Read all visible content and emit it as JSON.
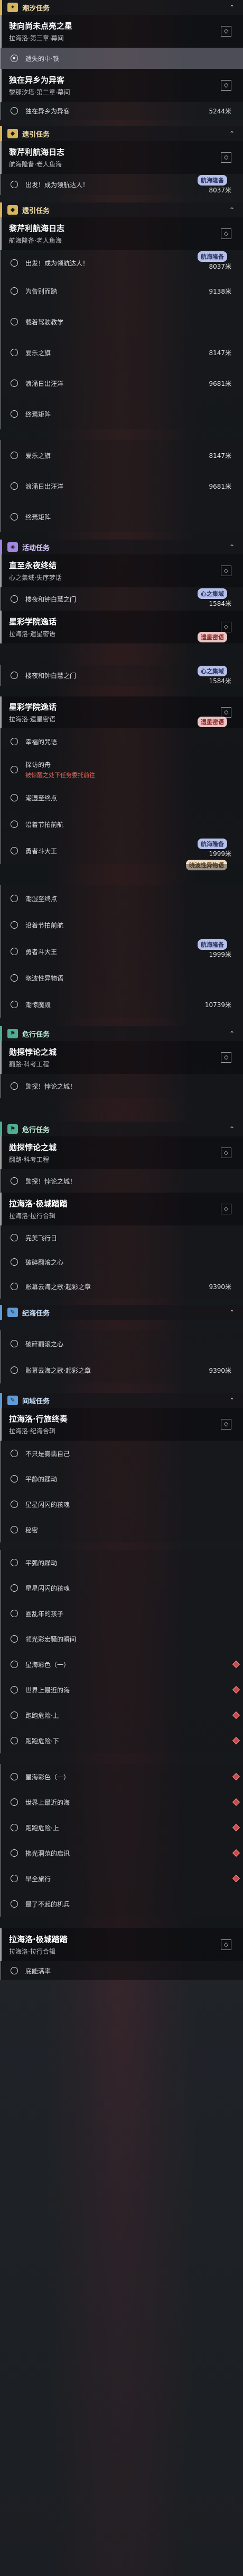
{
  "sections": {
    "s1_header": "潮汐任务",
    "s1_q1_title": "驶向尚未点亮之星",
    "s1_q1_sub": "拉海洛·第三章·幕间",
    "s1_q1_step": "遗失的中·铁",
    "s1_q2_title": "独在异乡为异客",
    "s1_q2_sub": "黎那汐塔·第二章·幕间",
    "s1_q2_step": "独在异乡为异客",
    "s1_q2_dist": "5244米",
    "s2_header": "遗引任务",
    "s2_q1_title": "黎芹利航海日志",
    "s2_q1_sub": "航海隆备·老人鱼海",
    "s2_q1_step": "出发！成为领航达人！",
    "s2_q1_badge": "航海隆备",
    "s2_q1_dist": "8037米",
    "s3_header": "遗引任务",
    "s3_q1_title": "黎芹利航海日志",
    "s3_q1_sub": "航海隆备·老人鱼海",
    "s3_steps": [
      {
        "label": "出发！成为领航达人！",
        "dist": "8037米",
        "badge": "航海隆备"
      },
      {
        "label": "为告别而踏",
        "dist": "9138米"
      },
      {
        "label": "载着驾驶教学",
        "dist": ""
      },
      {
        "label": "爱乐之旗",
        "dist": "8147米"
      },
      {
        "label": "浪涌日出汪洋",
        "dist": "9681米"
      },
      {
        "label": "终焉矩阵",
        "dist": ""
      }
    ],
    "s3b_steps": [
      {
        "label": "爱乐之旗",
        "dist": "8147米"
      },
      {
        "label": "浪涌日出汪洋",
        "dist": "9681米"
      },
      {
        "label": "终焉矩阵",
        "dist": ""
      }
    ],
    "s4_header": "活动任务",
    "s4_q1_title": "直至永夜终结",
    "s4_q1_sub": "心之集域·失序梦话",
    "s4_q1_step": "楼夜和钟白慧之门",
    "s4_q1_badge": "心之集域",
    "s4_q1_dist": "1584米",
    "s4_q2_title": "星彩学院逸话",
    "s4_q2_sub": "拉海洛·遗星密语",
    "s4_q2_badge": "遗星密语",
    "s4_q3_step": "楼夜和钟白慧之门",
    "s4_q3_badge": "心之集域",
    "s4_q3_dist": "1584米",
    "s4_q4_title": "星彩学院逸话",
    "s4_q4_sub": "拉海洛·遗星密语",
    "s4_q4_badge": "遗星密语",
    "s4_q4_steps": [
      {
        "label": "幸福的咒语",
        "sub": ""
      },
      {
        "label": "探访的舟",
        "sub": "被惊醒之处下任务委托前往"
      },
      {
        "label": "潮湿至终点",
        "sub": ""
      },
      {
        "label": "沿着节拍前航",
        "sub": ""
      },
      {
        "label": "勇者斗大王",
        "sub": "",
        "dist": "1999米",
        "badge": "航海隆备"
      }
    ],
    "s4_q4_note": "晓波性异物语",
    "s4_q5_steps": [
      {
        "label": "潮湿至终点"
      },
      {
        "label": "沿着节拍前航"
      },
      {
        "label": "勇者斗大王",
        "dist": "1999米",
        "badge": "航海隆备"
      },
      {
        "label": "晓波性异物语"
      },
      {
        "label": "潮惊魔毁",
        "dist": "10739米"
      }
    ],
    "s5_header": "危行任务",
    "s5_q1_title": "勋探悖论之城",
    "s5_q1_sub": "翻路·科考工程",
    "s5_q1_step": "勋探！悖论之城！",
    "s6_header": "危行任务",
    "s6_q1_title": "勋探悖论之城",
    "s6_q1_sub": "翻路·科考工程",
    "s6_q1_step": "勋探！悖论之城！",
    "s6_q2_title": "拉海洛·极城踏踏",
    "s6_q2_sub": "拉海洛·拉行合辑",
    "s6_q2_steps": [
      {
        "label": "完美飞行日"
      },
      {
        "label": "破碎翻滚之心"
      },
      {
        "label": "账幕云海之歌·起彩之章",
        "dist": "9390米"
      }
    ],
    "s7_header": "纪海任务",
    "s7_steps": [
      {
        "label": "破碎翻滚之心"
      },
      {
        "label": "账幕云海之歌·起彩之章",
        "dist": "9390米"
      }
    ],
    "s8_header": "间域任务",
    "s8_q1_title": "拉海洛·行旅终奏",
    "s8_q1_sub": "拉海洛·纪海合辑",
    "s8_steps": [
      "不只是雾翡自己",
      "平静的躁动",
      "星星闪闪的孩魂",
      "秘密",
      "平弧的躁动",
      "星星闪闪的孩魂",
      "圈乱年的孩子",
      "领光彩宏骚的瞬间",
      "星海彩色（一）",
      "世界上最近的海",
      "跑跑危险·上",
      "跑跑危险·下",
      "星海彩色（一）",
      "世界上最近的海",
      "跑跑危险·上",
      "拂光洞范的启讯",
      "早全旅行",
      "最了不起的机兵"
    ],
    "s9_q1_title": "拉海洛·极城踏踏",
    "s9_q1_sub": "拉海洛·拉行合辑",
    "s9_step": "底能满率"
  }
}
